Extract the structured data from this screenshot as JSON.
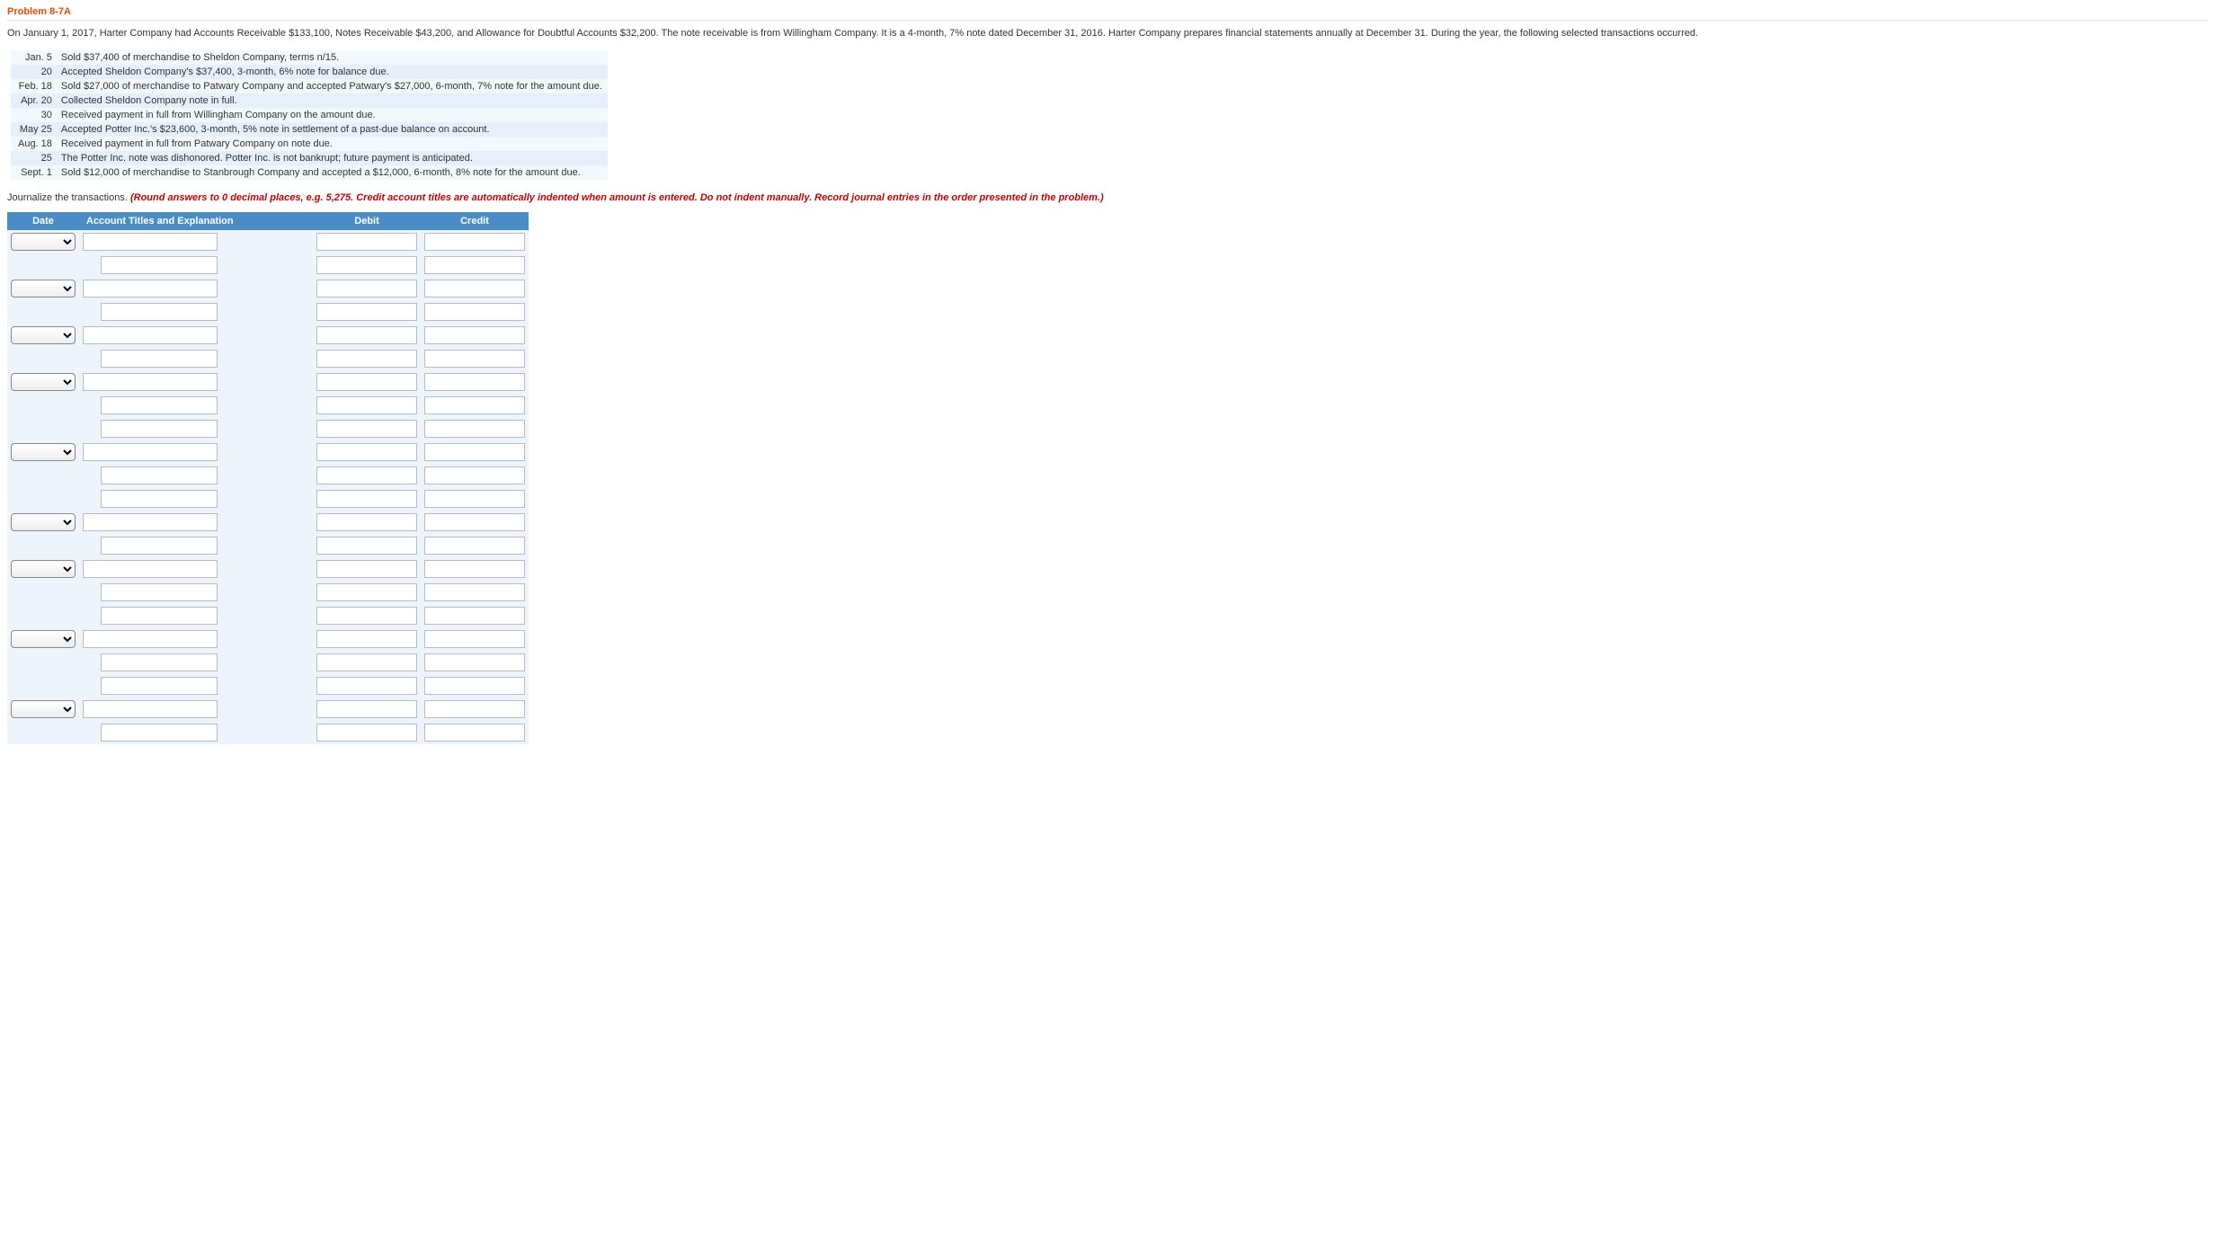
{
  "problem_title": "Problem 8-7A",
  "intro": "On January 1, 2017, Harter Company had Accounts Receivable $133,100, Notes Receivable $43,200, and Allowance for Doubtful Accounts $32,200. The note receivable is from Willingham Company. It is a 4-month, 7% note dated December 31, 2016. Harter Company prepares financial statements annually at December 31. During the year, the following selected transactions occurred.",
  "transactions": [
    {
      "date": "Jan.  5",
      "text": "Sold $37,400 of merchandise to Sheldon Company, terms n/15."
    },
    {
      "date": "20",
      "text": "Accepted Sheldon Company's $37,400, 3-month, 6% note for balance due."
    },
    {
      "date": "Feb. 18",
      "text": "Sold $27,000 of merchandise to Patwary Company and accepted Patwary's $27,000, 6-month, 7% note for the amount due."
    },
    {
      "date": "Apr. 20",
      "text": "Collected Sheldon Company note in full."
    },
    {
      "date": "30",
      "text": "Received payment in full from Willingham Company on the amount due."
    },
    {
      "date": "May 25",
      "text": "Accepted Potter Inc.'s $23,600, 3-month, 5% note in settlement of a past-due balance on account."
    },
    {
      "date": "Aug. 18",
      "text": "Received payment in full from Patwary Company on note due."
    },
    {
      "date": "25",
      "text": "The Potter Inc. note was dishonored. Potter Inc. is not bankrupt; future payment is anticipated."
    },
    {
      "date": "Sept. 1",
      "text": "Sold $12,000 of merchandise to Stanbrough Company and accepted a $12,000, 6-month, 8% note for the amount due."
    }
  ],
  "instruction_plain": "Journalize the transactions. ",
  "instruction_red": "(Round answers to 0 decimal places, e.g. 5,275. Credit account titles are automatically indented when amount is entered. Do not indent manually. Record journal entries in the order presented in the problem.)",
  "headers": {
    "date": "Date",
    "account": "Account Titles and Explanation",
    "debit": "Debit",
    "credit": "Credit"
  },
  "entries": [
    {
      "lines": 2
    },
    {
      "lines": 2
    },
    {
      "lines": 2
    },
    {
      "lines": 3
    },
    {
      "lines": 3
    },
    {
      "lines": 2
    },
    {
      "lines": 3
    },
    {
      "lines": 3
    },
    {
      "lines": 2
    }
  ]
}
